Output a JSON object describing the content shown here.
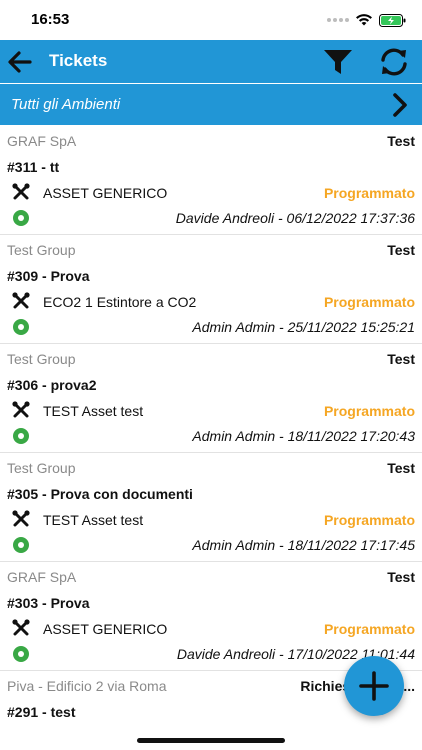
{
  "status_bar": {
    "time": "16:53"
  },
  "nav": {
    "title": "Tickets"
  },
  "environment": {
    "label": "Tutti gli Ambienti"
  },
  "tickets": [
    {
      "client": "GRAF SpA",
      "tag": "Test",
      "title": "#311 - tt",
      "asset": "ASSET GENERICO",
      "status": "Programmato",
      "meta": "Davide Andreoli - 06/12/2022 17:37:36"
    },
    {
      "client": "Test Group",
      "tag": "Test",
      "title": "#309 - Prova",
      "asset": "ECO2 1 Estintore a CO2",
      "status": "Programmato",
      "meta": "Admin Admin - 25/11/2022 15:25:21"
    },
    {
      "client": "Test Group",
      "tag": "Test",
      "title": "#306 - prova2",
      "asset": "TEST Asset test",
      "status": "Programmato",
      "meta": "Admin Admin - 18/11/2022 17:20:43"
    },
    {
      "client": "Test Group",
      "tag": "Test",
      "title": "#305 - Prova con documenti",
      "asset": "TEST Asset test",
      "status": "Programmato",
      "meta": "Admin Admin - 18/11/2022 17:17:45"
    },
    {
      "client": "GRAF SpA",
      "tag": "Test",
      "title": "#303 - Prova",
      "asset": "ASSET GENERICO",
      "status": "Programmato",
      "meta": "Davide Andreoli - 17/10/2022 11:01:44"
    },
    {
      "client": "Piva - Edificio 2 via Roma",
      "tag": "Richiesta Assis...",
      "title": "#291 - test",
      "asset": "",
      "status": "",
      "meta": ""
    }
  ],
  "colors": {
    "accent": "#2196D6",
    "status_scheduled": "#F5A623",
    "status_dot": "#39A845"
  },
  "icons": {
    "back": "arrow-left-icon",
    "filter": "filter-icon",
    "refresh": "refresh-icon",
    "chevron": "chevron-right-icon",
    "asset": "tools-icon",
    "add": "plus-icon"
  }
}
